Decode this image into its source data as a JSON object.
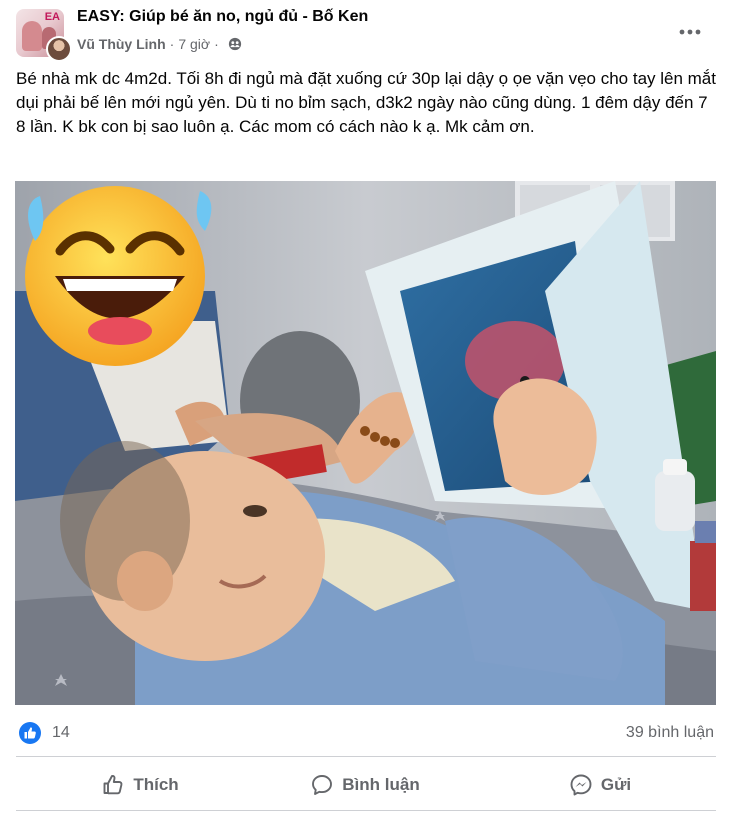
{
  "post": {
    "group_name": "EASY: Giúp bé ăn no, ngủ đủ - Bố Ken",
    "group_avatar_text": "EA",
    "author": "Vũ Thùy Linh",
    "separator": "·",
    "time": "7 giờ",
    "privacy_icon": "group-members-icon",
    "text": "Bé nhà mk dc 4m2d. Tối 8h đi ngủ mà đặt xuống cứ 30p lại dậy ọ ọe vặn vẹo cho tay lên mắt dụi phải bế lên mới ngủ yên. Dù ti no bỉm sạch, d3k2 ngày nào cũng dùng. 1 đêm dậy đến 7 8 lần. K bk con bị sao luôn ạ. Các mom có cách nào k ạ. Mk cảm ơn."
  },
  "reactions": {
    "like_count": "14",
    "comments": "39 bình luận",
    "like_color": "#1877f2"
  },
  "actions": {
    "like": "Thích",
    "comment": "Bình luận",
    "send": "Gửi"
  },
  "colors": {
    "text_primary": "#050505",
    "text_secondary": "#65676b",
    "divider": "#ced0d4"
  }
}
